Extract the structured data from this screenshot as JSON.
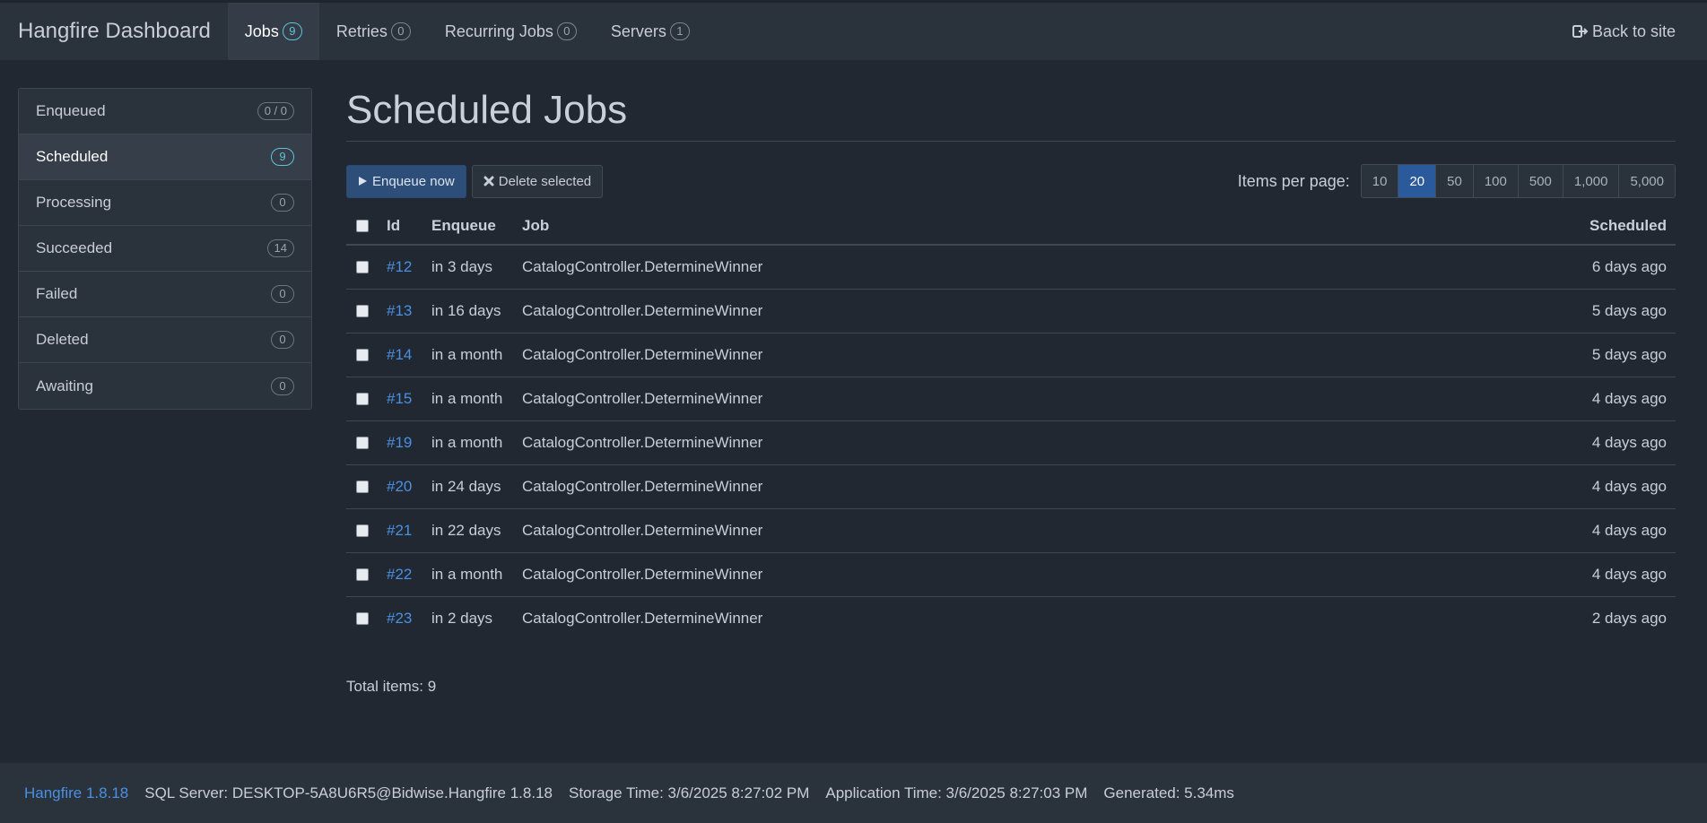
{
  "brand": "Hangfire Dashboard",
  "nav": [
    {
      "label": "Jobs",
      "count": "9",
      "active": true
    },
    {
      "label": "Retries",
      "count": "0"
    },
    {
      "label": "Recurring Jobs",
      "count": "0"
    },
    {
      "label": "Servers",
      "count": "1"
    }
  ],
  "back_to_site": "Back to site",
  "sidebar": [
    {
      "label": "Enqueued",
      "count": "0 / 0"
    },
    {
      "label": "Scheduled",
      "count": "9",
      "active": true
    },
    {
      "label": "Processing",
      "count": "0"
    },
    {
      "label": "Succeeded",
      "count": "14"
    },
    {
      "label": "Failed",
      "count": "0"
    },
    {
      "label": "Deleted",
      "count": "0"
    },
    {
      "label": "Awaiting",
      "count": "0"
    }
  ],
  "page_title": "Scheduled Jobs",
  "buttons": {
    "enqueue": "Enqueue now",
    "delete": "Delete selected"
  },
  "items_per_page_label": "Items per page:",
  "page_sizes": [
    "10",
    "20",
    "50",
    "100",
    "500",
    "1,000",
    "5,000"
  ],
  "active_page_size": "20",
  "table": {
    "headers": {
      "id": "Id",
      "enqueue": "Enqueue",
      "job": "Job",
      "scheduled": "Scheduled"
    },
    "rows": [
      {
        "id": "#12",
        "enqueue": "in 3 days",
        "job": "CatalogController.DetermineWinner",
        "scheduled": "6 days ago"
      },
      {
        "id": "#13",
        "enqueue": "in 16 days",
        "job": "CatalogController.DetermineWinner",
        "scheduled": "5 days ago"
      },
      {
        "id": "#14",
        "enqueue": "in a month",
        "job": "CatalogController.DetermineWinner",
        "scheduled": "5 days ago"
      },
      {
        "id": "#15",
        "enqueue": "in a month",
        "job": "CatalogController.DetermineWinner",
        "scheduled": "4 days ago"
      },
      {
        "id": "#19",
        "enqueue": "in a month",
        "job": "CatalogController.DetermineWinner",
        "scheduled": "4 days ago"
      },
      {
        "id": "#20",
        "enqueue": "in 24 days",
        "job": "CatalogController.DetermineWinner",
        "scheduled": "4 days ago"
      },
      {
        "id": "#21",
        "enqueue": "in 22 days",
        "job": "CatalogController.DetermineWinner",
        "scheduled": "4 days ago"
      },
      {
        "id": "#22",
        "enqueue": "in a month",
        "job": "CatalogController.DetermineWinner",
        "scheduled": "4 days ago"
      },
      {
        "id": "#23",
        "enqueue": "in 2 days",
        "job": "CatalogController.DetermineWinner",
        "scheduled": "2 days ago"
      }
    ]
  },
  "total_items": "Total items: 9",
  "footer": {
    "version": "Hangfire 1.8.18",
    "sql_server": "SQL Server: DESKTOP-5A8U6R5@Bidwise.Hangfire 1.8.18",
    "storage_time": "Storage Time: 3/6/2025 8:27:02 PM",
    "application_time": "Application Time: 3/6/2025 8:27:03 PM",
    "generated": "Generated: 5.34ms"
  },
  "colors": {
    "background": "#212831",
    "panel": "#2a323c",
    "link": "#4a90e2",
    "primary": "#2c4e78",
    "badge_active": "#5fc3d8"
  }
}
